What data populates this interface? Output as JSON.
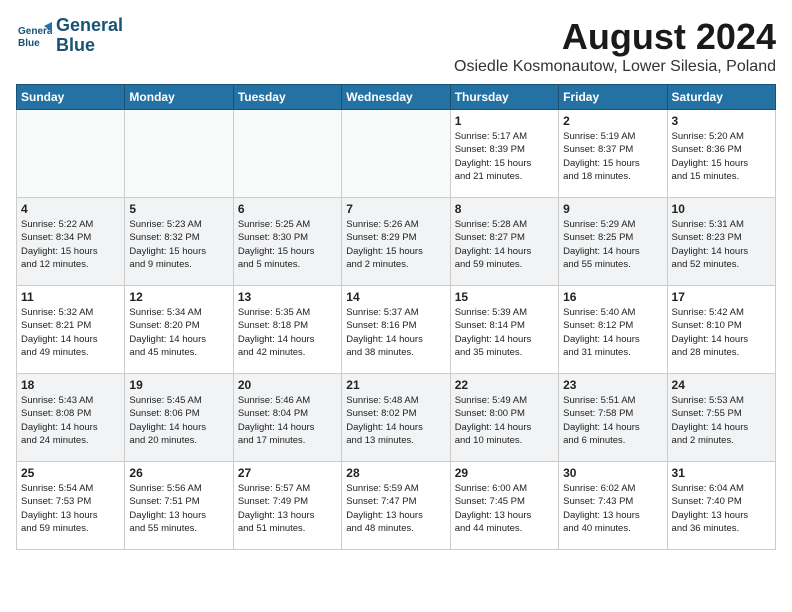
{
  "header": {
    "logo_line1": "General",
    "logo_line2": "Blue",
    "month": "August 2024",
    "location": "Osiedle Kosmonautow, Lower Silesia, Poland"
  },
  "weekdays": [
    "Sunday",
    "Monday",
    "Tuesday",
    "Wednesday",
    "Thursday",
    "Friday",
    "Saturday"
  ],
  "weeks": [
    [
      {
        "day": "",
        "info": ""
      },
      {
        "day": "",
        "info": ""
      },
      {
        "day": "",
        "info": ""
      },
      {
        "day": "",
        "info": ""
      },
      {
        "day": "1",
        "info": "Sunrise: 5:17 AM\nSunset: 8:39 PM\nDaylight: 15 hours\nand 21 minutes."
      },
      {
        "day": "2",
        "info": "Sunrise: 5:19 AM\nSunset: 8:37 PM\nDaylight: 15 hours\nand 18 minutes."
      },
      {
        "day": "3",
        "info": "Sunrise: 5:20 AM\nSunset: 8:36 PM\nDaylight: 15 hours\nand 15 minutes."
      }
    ],
    [
      {
        "day": "4",
        "info": "Sunrise: 5:22 AM\nSunset: 8:34 PM\nDaylight: 15 hours\nand 12 minutes."
      },
      {
        "day": "5",
        "info": "Sunrise: 5:23 AM\nSunset: 8:32 PM\nDaylight: 15 hours\nand 9 minutes."
      },
      {
        "day": "6",
        "info": "Sunrise: 5:25 AM\nSunset: 8:30 PM\nDaylight: 15 hours\nand 5 minutes."
      },
      {
        "day": "7",
        "info": "Sunrise: 5:26 AM\nSunset: 8:29 PM\nDaylight: 15 hours\nand 2 minutes."
      },
      {
        "day": "8",
        "info": "Sunrise: 5:28 AM\nSunset: 8:27 PM\nDaylight: 14 hours\nand 59 minutes."
      },
      {
        "day": "9",
        "info": "Sunrise: 5:29 AM\nSunset: 8:25 PM\nDaylight: 14 hours\nand 55 minutes."
      },
      {
        "day": "10",
        "info": "Sunrise: 5:31 AM\nSunset: 8:23 PM\nDaylight: 14 hours\nand 52 minutes."
      }
    ],
    [
      {
        "day": "11",
        "info": "Sunrise: 5:32 AM\nSunset: 8:21 PM\nDaylight: 14 hours\nand 49 minutes."
      },
      {
        "day": "12",
        "info": "Sunrise: 5:34 AM\nSunset: 8:20 PM\nDaylight: 14 hours\nand 45 minutes."
      },
      {
        "day": "13",
        "info": "Sunrise: 5:35 AM\nSunset: 8:18 PM\nDaylight: 14 hours\nand 42 minutes."
      },
      {
        "day": "14",
        "info": "Sunrise: 5:37 AM\nSunset: 8:16 PM\nDaylight: 14 hours\nand 38 minutes."
      },
      {
        "day": "15",
        "info": "Sunrise: 5:39 AM\nSunset: 8:14 PM\nDaylight: 14 hours\nand 35 minutes."
      },
      {
        "day": "16",
        "info": "Sunrise: 5:40 AM\nSunset: 8:12 PM\nDaylight: 14 hours\nand 31 minutes."
      },
      {
        "day": "17",
        "info": "Sunrise: 5:42 AM\nSunset: 8:10 PM\nDaylight: 14 hours\nand 28 minutes."
      }
    ],
    [
      {
        "day": "18",
        "info": "Sunrise: 5:43 AM\nSunset: 8:08 PM\nDaylight: 14 hours\nand 24 minutes."
      },
      {
        "day": "19",
        "info": "Sunrise: 5:45 AM\nSunset: 8:06 PM\nDaylight: 14 hours\nand 20 minutes."
      },
      {
        "day": "20",
        "info": "Sunrise: 5:46 AM\nSunset: 8:04 PM\nDaylight: 14 hours\nand 17 minutes."
      },
      {
        "day": "21",
        "info": "Sunrise: 5:48 AM\nSunset: 8:02 PM\nDaylight: 14 hours\nand 13 minutes."
      },
      {
        "day": "22",
        "info": "Sunrise: 5:49 AM\nSunset: 8:00 PM\nDaylight: 14 hours\nand 10 minutes."
      },
      {
        "day": "23",
        "info": "Sunrise: 5:51 AM\nSunset: 7:58 PM\nDaylight: 14 hours\nand 6 minutes."
      },
      {
        "day": "24",
        "info": "Sunrise: 5:53 AM\nSunset: 7:55 PM\nDaylight: 14 hours\nand 2 minutes."
      }
    ],
    [
      {
        "day": "25",
        "info": "Sunrise: 5:54 AM\nSunset: 7:53 PM\nDaylight: 13 hours\nand 59 minutes."
      },
      {
        "day": "26",
        "info": "Sunrise: 5:56 AM\nSunset: 7:51 PM\nDaylight: 13 hours\nand 55 minutes."
      },
      {
        "day": "27",
        "info": "Sunrise: 5:57 AM\nSunset: 7:49 PM\nDaylight: 13 hours\nand 51 minutes."
      },
      {
        "day": "28",
        "info": "Sunrise: 5:59 AM\nSunset: 7:47 PM\nDaylight: 13 hours\nand 48 minutes."
      },
      {
        "day": "29",
        "info": "Sunrise: 6:00 AM\nSunset: 7:45 PM\nDaylight: 13 hours\nand 44 minutes."
      },
      {
        "day": "30",
        "info": "Sunrise: 6:02 AM\nSunset: 7:43 PM\nDaylight: 13 hours\nand 40 minutes."
      },
      {
        "day": "31",
        "info": "Sunrise: 6:04 AM\nSunset: 7:40 PM\nDaylight: 13 hours\nand 36 minutes."
      }
    ]
  ]
}
